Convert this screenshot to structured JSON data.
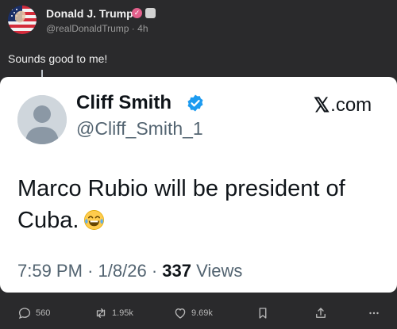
{
  "post": {
    "author_name": "Donald J. Trump",
    "handle": "@realDonaldTrump",
    "time": "4h",
    "text": "Sounds good to me!"
  },
  "quote": {
    "name": "Cliff Smith",
    "handle": "@Cliff_Smith_1",
    "source_x": "𝕏",
    "source_domain": ".com",
    "text": "Marco Rubio will be president of Cuba.",
    "time": "7:59 PM",
    "date": "1/8/26",
    "views_count": "337",
    "views_label": "Views"
  },
  "actions": {
    "replies": "560",
    "reposts": "1.95k",
    "likes": "9.69k"
  },
  "colors": {
    "background": "#2a2a2c",
    "card": "#ffffff",
    "verified_blue": "#1d9bf0",
    "badge_pink": "#e3608c",
    "icon_gray": "#b8b8b8"
  },
  "icons": [
    "flag-avatar-icon",
    "verified-badge-icon",
    "default-avatar-icon",
    "laughing-emoji-icon",
    "reply-icon",
    "repost-icon",
    "like-icon",
    "bookmark-icon",
    "share-icon",
    "more-icon"
  ]
}
